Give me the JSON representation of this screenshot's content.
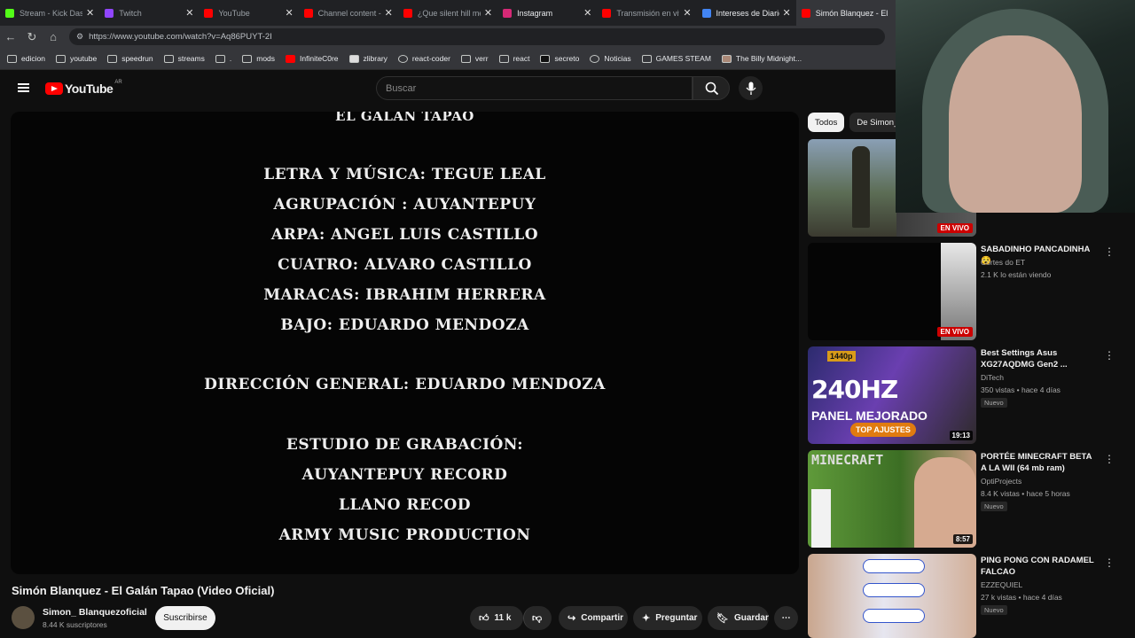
{
  "browser": {
    "tabs": [
      {
        "label": "Stream - Kick Dashbo",
        "color": "#53fc18",
        "active": false
      },
      {
        "label": "Twitch",
        "color": "#9146ff",
        "active": false
      },
      {
        "label": "YouTube",
        "color": "#ff0000",
        "active": false
      },
      {
        "label": "Channel content - Yo",
        "color": "#ff0000",
        "active": false
      },
      {
        "label": "¿Que silent hill me n",
        "color": "#ff0000",
        "active": false
      },
      {
        "label": "Instagram",
        "color": "#d62976",
        "active": false
      },
      {
        "label": "Transmisión en vivo",
        "color": "#ff0000",
        "active": false
      },
      {
        "label": "Intereses de Diarios",
        "color": "#4285f4",
        "active": false
      },
      {
        "label": "Simón Blanquez - El",
        "color": "#ff0000",
        "active": true
      }
    ],
    "url": "https://www.youtube.com/watch?v=Aq86PUYT-2I",
    "bookmarks": [
      "edicion",
      "youtube",
      "speedrun",
      "streams",
      ".",
      "mods",
      "InfiniteC0re",
      "zlibrary",
      "react-coder",
      "verr",
      "react",
      "secreto",
      "Noticias",
      "GAMES STEAM",
      "The Billy Midnight..."
    ]
  },
  "youtube": {
    "logo_text": "YouTube",
    "country": "AR",
    "search_placeholder": "Buscar",
    "credits": [
      "EL GALÁN TAPAO",
      "LETRA Y MÚSICA: TEGUE LEAL",
      "AGRUPACIÓN : AUYANTEPUY",
      "ARPA: ANGEL LUIS CASTILLO",
      "CUATRO: ALVARO CASTILLO",
      "MARACAS: IBRAHIM HERRERA",
      "BAJO: EDUARDO MENDOZA",
      "DIRECCIÓN GENERAL: EDUARDO MENDOZA",
      "ESTUDIO DE GRABACIÓN:",
      "AUYANTEPUY RECORD",
      "LLANO RECOD",
      "ARMY MUSIC PRODUCTION"
    ],
    "video_title": "Simón Blanquez - El Galán Tapao (Video Oficial)",
    "channel": "Simon_ Blanquezoficial",
    "subscribers": "8.44 K suscriptores",
    "subscribe": "Suscribirse",
    "likes": "11 k",
    "share": "Compartir",
    "ask": "Preguntar",
    "save": "Guardar",
    "chips": [
      "Todos",
      "De Simon_"
    ],
    "live_badge": "EN VIVO",
    "recommendations": [
      {
        "title": "",
        "channel": "",
        "meta": "",
        "badge": "EN VIVO",
        "new": ""
      },
      {
        "title": "SABADINHO PANCADINHA 😵",
        "channel": "Cortes do ET",
        "meta": "2.1 K lo están viendo",
        "badge": "EN VIVO",
        "new": ""
      },
      {
        "title": "Best Settings Asus XG27AQDMG Gen2 ...",
        "channel": "DiTech",
        "meta": "350 vistas • hace 4 días",
        "badge": "19:13",
        "new": "Nuevo"
      },
      {
        "title": "PORTÉE MINECRAFT BETA A LA WII (64 mb ram)",
        "channel": "OptiProjects",
        "meta": "8.4 K vistas • hace 5 horas",
        "badge": "8:57",
        "new": "Nuevo"
      },
      {
        "title": "PING PONG CON RADAMEL FALCAO",
        "channel": "EZZEQUIEL",
        "meta": "27 k vistas • hace 4 días",
        "badge": "",
        "new": "Nuevo"
      }
    ],
    "thumb_text": {
      "hz": "240HZ",
      "panel": "PANEL MEJORADO",
      "ajustes": "TOP AJUSTES",
      "res": "1440p",
      "mc": "MINECRAFT"
    }
  }
}
